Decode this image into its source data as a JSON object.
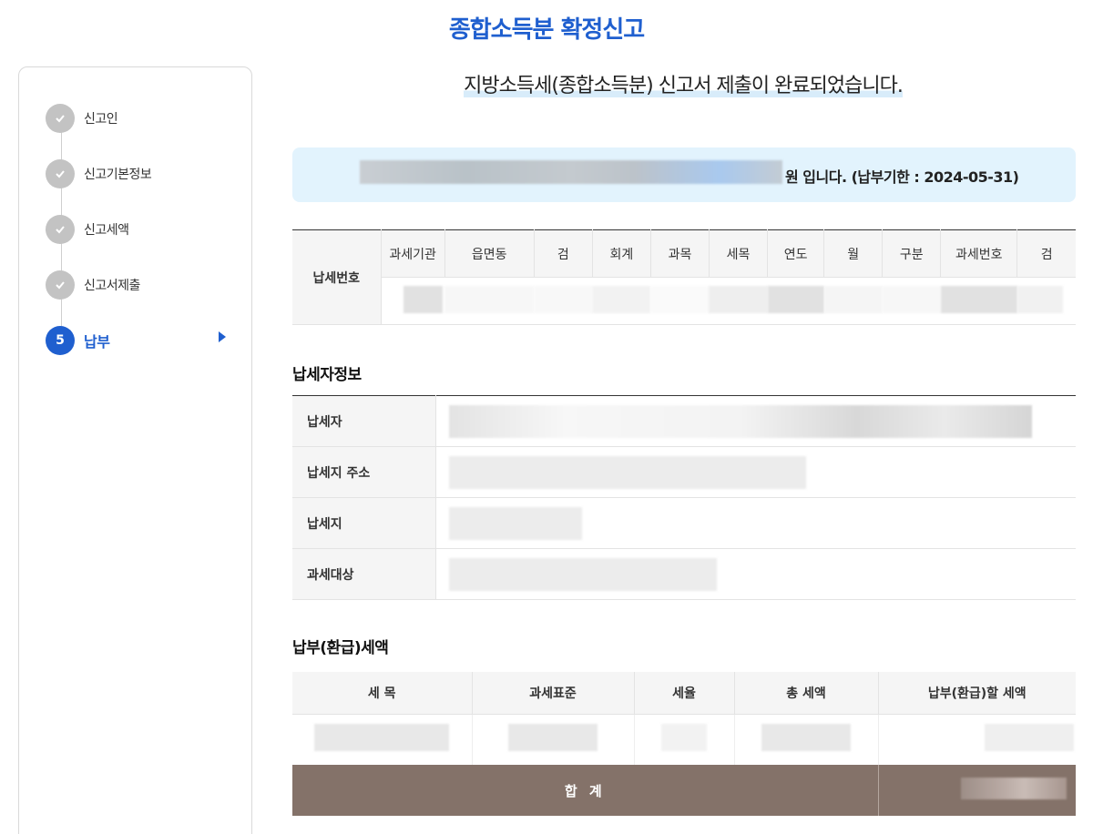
{
  "header": {
    "title": "종합소득분 확정신고"
  },
  "sidebar": {
    "steps": [
      {
        "label": "신고인",
        "status": "done"
      },
      {
        "label": "신고기본정보",
        "status": "done"
      },
      {
        "label": "신고세액",
        "status": "done"
      },
      {
        "label": "신고서제출",
        "status": "done"
      },
      {
        "number": "5",
        "label": "납부",
        "status": "active"
      }
    ]
  },
  "main": {
    "complete_message": "지방소득세(종합소득분) 신고서 제출이 완료되었습니다.",
    "amount_suffix": "원 입니다. (납부기한 : 2024-05-31)",
    "tax_number_table": {
      "row_label": "납세번호",
      "columns": [
        "과세기관",
        "읍면동",
        "검",
        "회계",
        "과목",
        "세목",
        "연도",
        "월",
        "구분",
        "과세번호",
        "검"
      ]
    },
    "payer_section": {
      "title": "납세자정보",
      "rows": [
        "납세자",
        "납세지 주소",
        "납세지",
        "과세대상"
      ]
    },
    "payment_section": {
      "title": "납부(환급)세액",
      "columns": [
        "세 목",
        "과세표준",
        "세율",
        "총 세액",
        "납부(환급)할 세액"
      ],
      "total_label": "합 계"
    }
  },
  "colors": {
    "accent": "#1f5fcf",
    "total_row": "#847269",
    "info_box": "#e2f3fd"
  }
}
